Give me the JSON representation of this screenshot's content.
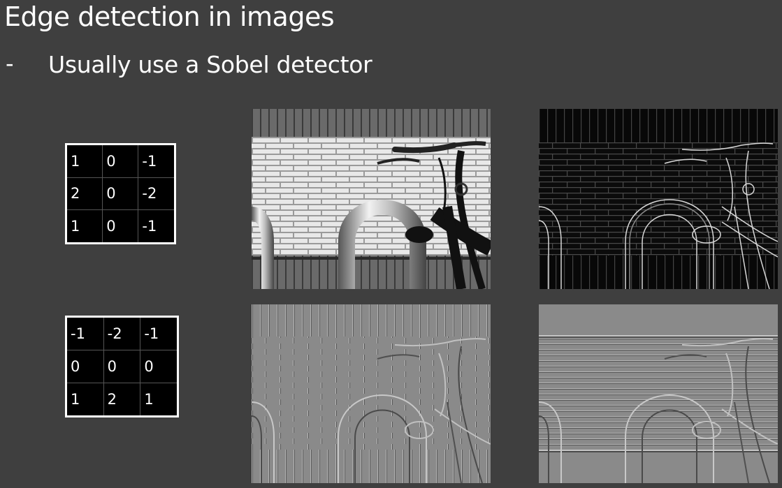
{
  "slide": {
    "title": "Edge detection in images",
    "bullet_marker": "-",
    "bullet": "Usually use a Sobel detector"
  },
  "kernels": {
    "horizontal": [
      [
        "1",
        "0",
        "-1"
      ],
      [
        "2",
        "0",
        "-2"
      ],
      [
        "1",
        "0",
        "-1"
      ]
    ],
    "vertical": [
      [
        "-1",
        "-2",
        "-1"
      ],
      [
        "0",
        "0",
        "0"
      ],
      [
        "1",
        "2",
        "1"
      ]
    ]
  },
  "images": {
    "original": "photo-icon",
    "magnitude": "photo-icon",
    "gradient_x": "photo-icon",
    "gradient_y": "photo-icon"
  },
  "colors": {
    "background": "#3f3f3f",
    "text": "#ffffff",
    "kernel_bg": "#000000"
  }
}
